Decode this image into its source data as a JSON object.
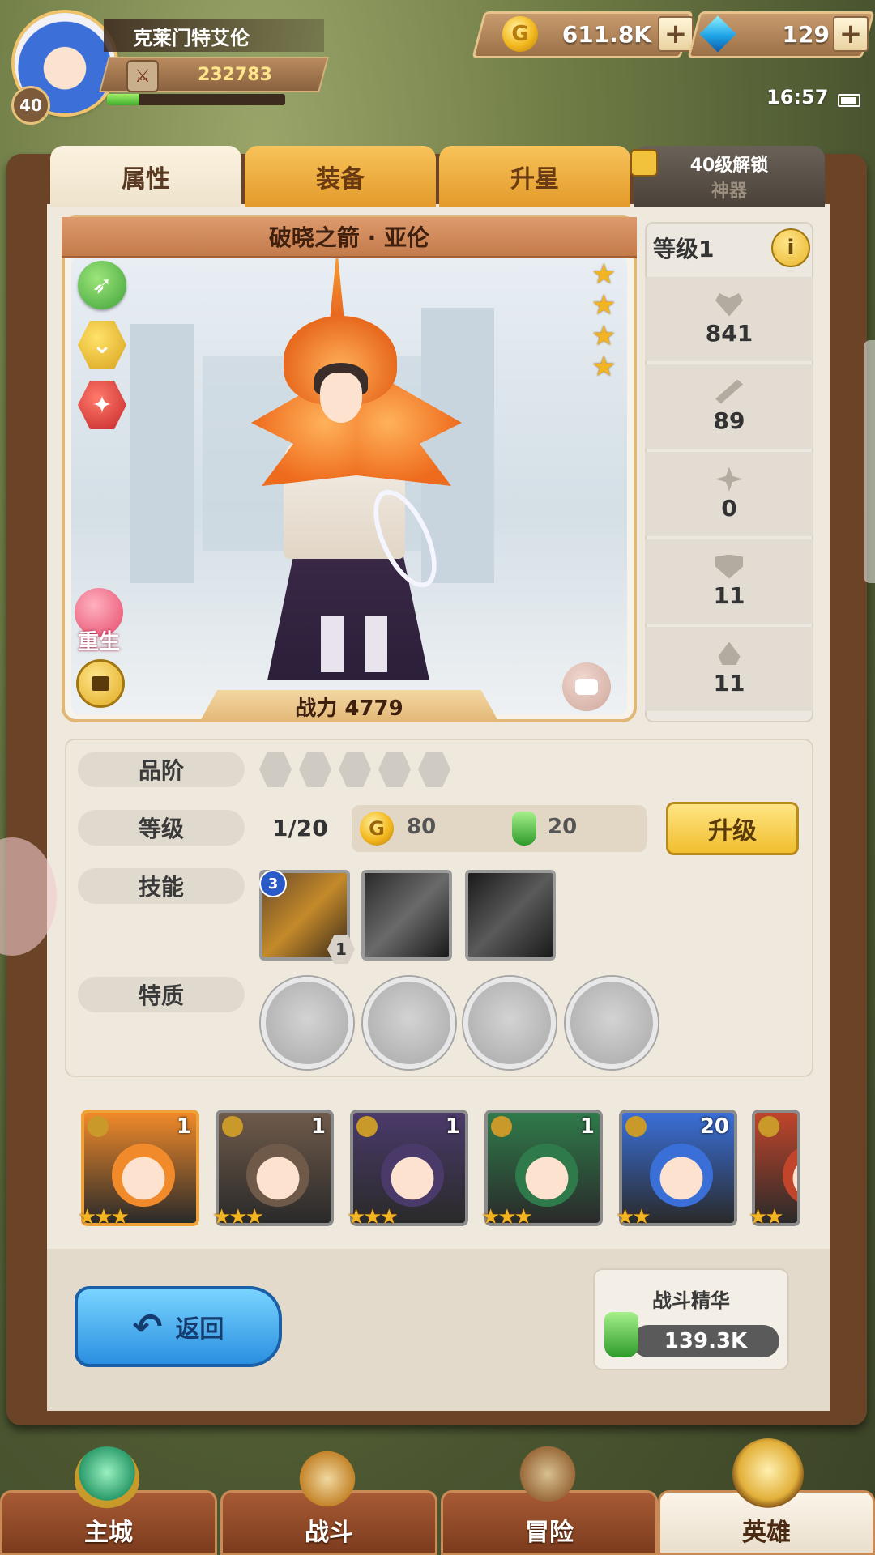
{
  "player": {
    "name": "克莱门特艾伦",
    "level": "40",
    "power": "232783",
    "exp_fraction": 0.18
  },
  "resources": {
    "gold": "611.8K",
    "gold_icon_glyph": "G",
    "gems": "129",
    "plus_glyph": "+"
  },
  "status": {
    "time": "16:57"
  },
  "tabs": [
    {
      "label": "属性"
    },
    {
      "label": "装备"
    },
    {
      "label": "升星"
    },
    {
      "label": "神器",
      "lock_text": "40级解锁"
    }
  ],
  "hero": {
    "title": "破晓之箭 · 亚伦",
    "stars": 4,
    "star_glyph": "★",
    "battle_power": "战力 4779",
    "rebirth_label": "重生",
    "badges": [
      "bow-class-icon",
      "rank-chevron-icon",
      "attack-type-icon"
    ]
  },
  "stats": {
    "level_label": "等级1",
    "info_glyph": "i",
    "values": [
      {
        "icon": "heart-icon",
        "value": "841"
      },
      {
        "icon": "sword-icon",
        "value": "89"
      },
      {
        "icon": "crit-icon",
        "value": "0"
      },
      {
        "icon": "shield-icon",
        "value": "11"
      },
      {
        "icon": "drop-icon",
        "value": "11"
      }
    ]
  },
  "details": {
    "rank_label": "品阶",
    "level_label": "等级",
    "level_value": "1/20",
    "cost_gold": "80",
    "cost_potion": "20",
    "upgrade_label": "升级",
    "skills_label": "技能",
    "skill_rank": "3",
    "skill_level": "1",
    "traits_label": "特质"
  },
  "roster": [
    {
      "level": "1",
      "stars": "★★★",
      "color": "#f08a2a"
    },
    {
      "level": "1",
      "stars": "★★★",
      "color": "#6f5a4a"
    },
    {
      "level": "1",
      "stars": "★★★",
      "color": "#4a3a6a"
    },
    {
      "level": "1",
      "stars": "★★★",
      "color": "#2f7a4a"
    },
    {
      "level": "20",
      "stars": "★★",
      "color": "#3a6fd8"
    },
    {
      "level": "",
      "stars": "★★",
      "color": "#c0452a"
    }
  ],
  "footer": {
    "back_label": "返回",
    "essence_title": "战斗精华",
    "essence_value": "139.3K"
  },
  "nav": [
    {
      "label": "主城"
    },
    {
      "label": "战斗"
    },
    {
      "label": "冒险"
    },
    {
      "label": "英雄"
    }
  ]
}
